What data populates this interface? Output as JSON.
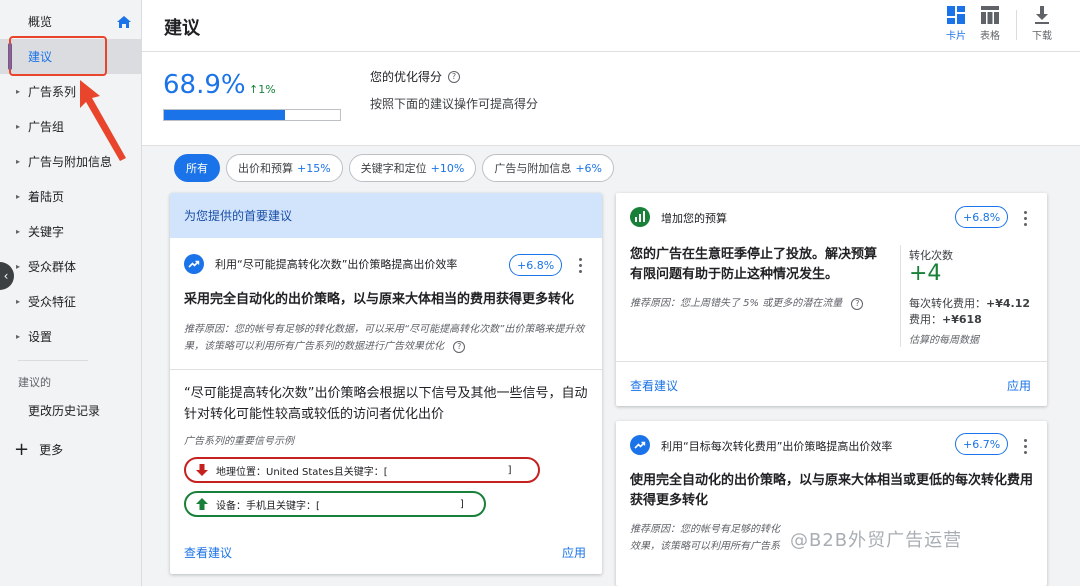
{
  "sidebar": {
    "items": [
      {
        "label": "概览"
      },
      {
        "label": "建议"
      },
      {
        "label": "广告系列"
      },
      {
        "label": "广告组"
      },
      {
        "label": "广告与附加信息"
      },
      {
        "label": "着陆页"
      },
      {
        "label": "关键字"
      },
      {
        "label": "受众群体"
      },
      {
        "label": "受众特征"
      },
      {
        "label": "设置"
      }
    ],
    "group_label": "建议的",
    "history_label": "更改历史记录",
    "more_label": "更多"
  },
  "header": {
    "title": "建议",
    "views": [
      {
        "label": "卡片",
        "icon": "card-view-icon"
      },
      {
        "label": "表格",
        "icon": "table-view-icon"
      }
    ],
    "download_label": "下载"
  },
  "score": {
    "value": "68.9%",
    "delta": "1%",
    "progress": 0.689,
    "title": "您的优化得分",
    "description": "按照下面的建议操作可提高得分"
  },
  "filters": [
    {
      "label": "所有",
      "pct": ""
    },
    {
      "label": "出价和预算",
      "pct": "+15%"
    },
    {
      "label": "关键字和定位",
      "pct": "+10%"
    },
    {
      "label": "广告与附加信息",
      "pct": "+6%"
    }
  ],
  "top_card": {
    "header": "为您提供的首要建议",
    "rec_title": "利用“尽可能提高转化次数”出价策略提高出价效率",
    "badge": "+6.8%",
    "headline": "采用完全自动化的出价策略，以与原来大体相当的费用获得更多转化",
    "reason": "推荐原因：您的帐号有足够的转化数据，可以采用“尽可能提高转化次数”出价策略来提升效果，该策略可以利用所有广告系列的数据进行广告效果优化",
    "explain": "“尽可能提高转化次数”出价策略会根据以下信号及其他一些信号，自动针对转化可能性较高或较低的访问者优化出价",
    "signals_label": "广告系列的重要信号示例",
    "signals": [
      {
        "text": "地理位置：United States且关键字：[",
        "end": "]",
        "direction": "down",
        "color": "#c5221f"
      },
      {
        "text": "设备：手机且关键字：[",
        "end": "]",
        "direction": "up",
        "color": "#188038"
      }
    ],
    "view_label": "查看建议",
    "apply_label": "应用"
  },
  "budget_card": {
    "title": "增加您的预算",
    "badge": "+6.8%",
    "text": "您的广告在生意旺季停止了投放。解决预算有限问题有助于防止这种情况发生。",
    "reason": "推荐原因：您上周错失了 5% 或更多的潜在流量",
    "stat_label": "转化次数",
    "stat_value": "+4",
    "cost_label": "每次转化费用：",
    "cost_value": "+¥4.12",
    "fee_label": "费用：",
    "fee_value": "+¥618",
    "estimate": "估算的每周数据",
    "view_label": "查看建议",
    "apply_label": "应用"
  },
  "tcpa_card": {
    "title": "利用“目标每次转化费用”出价策略提高出价效率",
    "badge": "+6.7%",
    "headline": "使用完全自动化的出价策略，以与原来大体相当或更低的每次转化费用获得更多转化",
    "reason_line1": "推荐原因：您的帐号有足够的转化",
    "reason_line2": "效果，该策略可以利用所有广告系"
  },
  "watermark": "@B2B外贸广告运营",
  "colors": {
    "accent": "#1a73e8",
    "positive": "#188038",
    "negative": "#c5221f",
    "annotation": "#e8452c"
  }
}
